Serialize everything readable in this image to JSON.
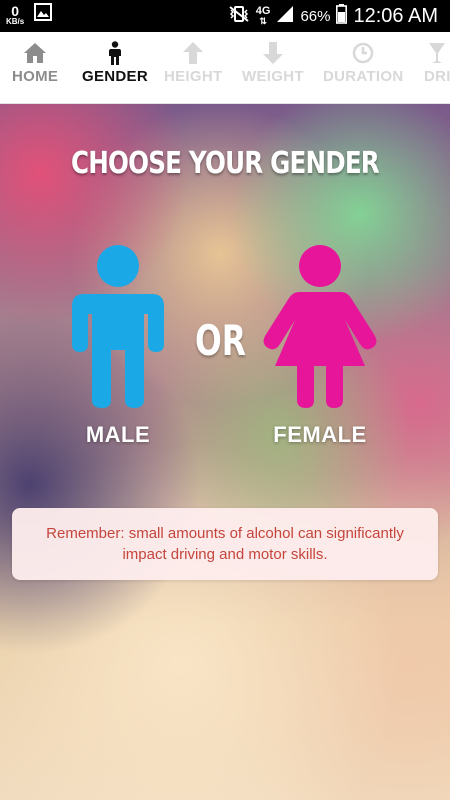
{
  "status_bar": {
    "data_rate": "0",
    "data_unit": "KB/s",
    "network": "4G",
    "battery": "66%",
    "time": "12:06 AM"
  },
  "tabs": [
    {
      "label": "HOME",
      "icon": "home-icon",
      "state": "visited"
    },
    {
      "label": "GENDER",
      "icon": "person-icon",
      "state": "active"
    },
    {
      "label": "HEIGHT",
      "icon": "arrow-up-icon",
      "state": "disabled"
    },
    {
      "label": "WEIGHT",
      "icon": "arrow-down-icon",
      "state": "disabled"
    },
    {
      "label": "DURATION",
      "icon": "clock-icon",
      "state": "disabled"
    },
    {
      "label": "DRI",
      "icon": "glass-icon",
      "state": "disabled"
    }
  ],
  "main": {
    "title": "CHOOSE YOUR GENDER",
    "male_label": "MALE",
    "or_label": "OR",
    "female_label": "FEMALE",
    "reminder": "Remember: small amounts of alcohol can significantly impact driving and motor skills."
  },
  "colors": {
    "male": "#1aa8e6",
    "female": "#e6159a",
    "reminder_text": "#c5453c",
    "reminder_bg": "#fdecec"
  }
}
